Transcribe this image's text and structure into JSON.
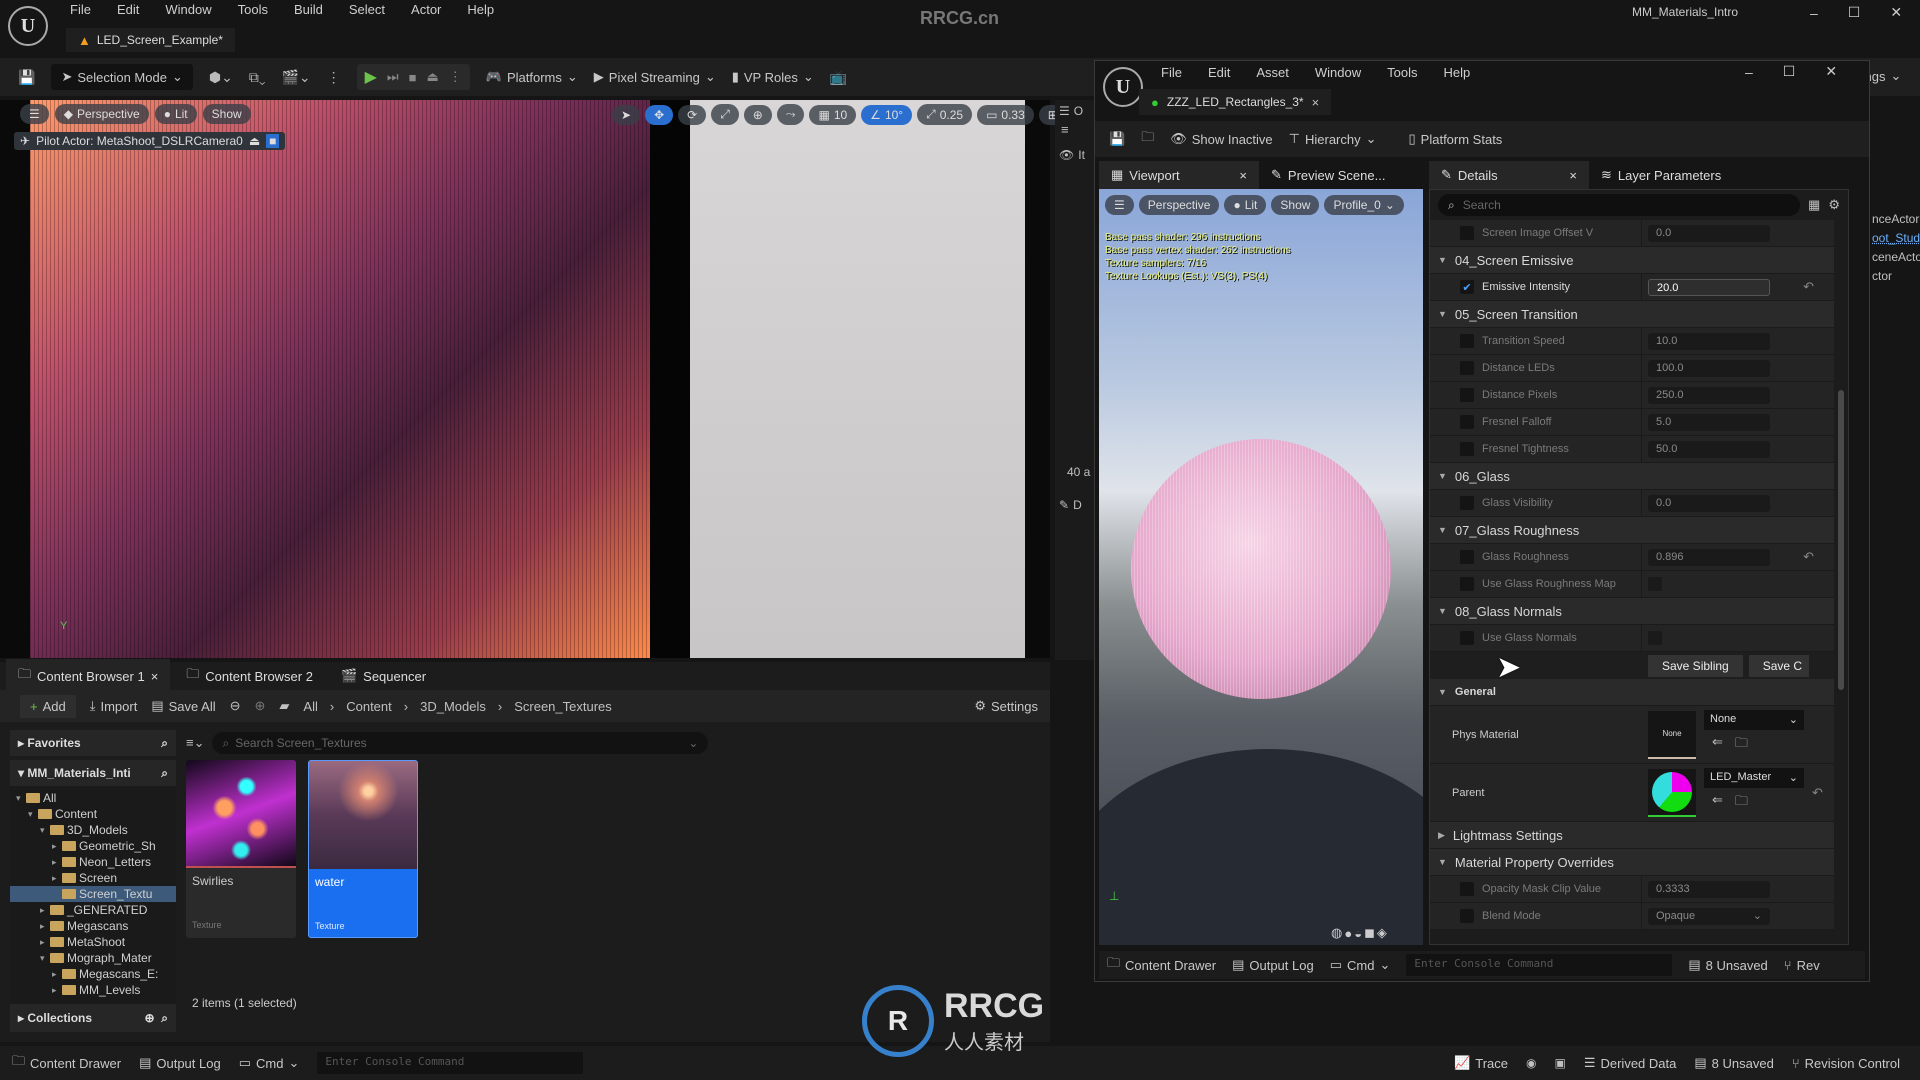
{
  "main_window": {
    "title": "MM_Materials_Intro",
    "watermark": "RRCG.cn",
    "menu": [
      "File",
      "Edit",
      "Window",
      "Tools",
      "Build",
      "Select",
      "Actor",
      "Help"
    ],
    "level_tab": "LED_Screen_Example*",
    "toolbar": {
      "selection_mode": "Selection Mode",
      "platforms": "Platforms",
      "pixel_streaming": "Pixel Streaming",
      "vp_roles": "VP Roles",
      "settings_partial": "tings"
    },
    "viewport": {
      "perspective": "Perspective",
      "lit": "Lit",
      "show": "Show",
      "grid": "10",
      "angle": "10°",
      "scale": "0.25",
      "camera_speed": "0.33",
      "pilot": "Pilot Actor: MetaShoot_DSLRCamera0",
      "axis_label": "Y"
    },
    "outliner_partial": {
      "header": "O",
      "item": "It",
      "count": "40 a",
      "details": "D",
      "items": [
        "nceActor",
        "oot_Studic",
        "ceneActor",
        "ctor"
      ]
    },
    "content_browser": {
      "tabs": [
        "Content Browser 1",
        "Content Browser 2",
        "Sequencer"
      ],
      "add": "Add",
      "import": "Import",
      "save_all": "Save All",
      "breadcrumb": [
        "All",
        "Content",
        "3D_Models",
        "Screen_Textures"
      ],
      "settings": "Settings",
      "favorites": "Favorites",
      "root": "MM_Materials_Inti",
      "search_placeholder": "Search Screen_Textures",
      "tree": [
        {
          "label": "All",
          "depth": 0,
          "open": true
        },
        {
          "label": "Content",
          "depth": 1,
          "open": true
        },
        {
          "label": "3D_Models",
          "depth": 2,
          "open": true
        },
        {
          "label": "Geometric_Sh",
          "depth": 3
        },
        {
          "label": "Neon_Letters",
          "depth": 3
        },
        {
          "label": "Screen",
          "depth": 3
        },
        {
          "label": "Screen_Textu",
          "depth": 3,
          "selected": true
        },
        {
          "label": "_GENERATED",
          "depth": 2
        },
        {
          "label": "Megascans",
          "depth": 2
        },
        {
          "label": "MetaShoot",
          "depth": 2
        },
        {
          "label": "Mograph_Mater",
          "depth": 2,
          "open": true
        },
        {
          "label": "Megascans_E:",
          "depth": 3
        },
        {
          "label": "MM_Levels",
          "depth": 3
        }
      ],
      "collections": "Collections",
      "assets": [
        {
          "name": "Swirlies",
          "type": "Texture",
          "selected": false
        },
        {
          "name": "water",
          "type": "Texture",
          "selected": true
        }
      ],
      "status": "2 items (1 selected)"
    },
    "status_bar": {
      "content_drawer": "Content Drawer",
      "output_log": "Output Log",
      "cmd": "Cmd",
      "console_placeholder": "Enter Console Command",
      "trace": "Trace",
      "derived_data": "Derived Data",
      "unsaved": "8 Unsaved",
      "revision_control": "Revision Control"
    }
  },
  "material_editor": {
    "menu": [
      "File",
      "Edit",
      "Asset",
      "Window",
      "Tools",
      "Help"
    ],
    "asset_tab": "ZZZ_LED_Rectangles_3*",
    "toolbar": {
      "show_inactive": "Show Inactive",
      "hierarchy": "Hierarchy",
      "platform_stats": "Platform Stats"
    },
    "panel_tabs": [
      "Viewport",
      "Preview Scene...",
      "Details",
      "Layer Parameters"
    ],
    "viewport": {
      "perspective": "Perspective",
      "lit": "Lit",
      "show": "Show",
      "profile": "Profile_0",
      "stats": [
        "Base pass shader: 296 instructions",
        "Base pass vertex shader: 262 instructions",
        "Texture samplers: 7/16",
        "Texture Lookups (Est.): VS(3), PS(4)"
      ]
    },
    "details": {
      "search_placeholder": "Search",
      "top_row": {
        "name": "Screen Image Offset V",
        "value": "0.0"
      },
      "sections": [
        {
          "title": "04_Screen Emissive",
          "rows": [
            {
              "name": "Emissive Intensity",
              "value": "20.0",
              "checked": true,
              "reset": true
            }
          ]
        },
        {
          "title": "05_Screen Transition",
          "rows": [
            {
              "name": "Transition Speed",
              "value": "10.0"
            },
            {
              "name": "Distance LEDs",
              "value": "100.0"
            },
            {
              "name": "Distance Pixels",
              "value": "250.0"
            },
            {
              "name": "Fresnel Falloff",
              "value": "5.0"
            },
            {
              "name": "Fresnel Tightness",
              "value": "50.0"
            }
          ]
        },
        {
          "title": "06_Glass",
          "rows": [
            {
              "name": "Glass Visibility",
              "value": "0.0"
            }
          ]
        },
        {
          "title": "07_Glass Roughness",
          "rows": [
            {
              "name": "Glass Roughness",
              "value": "0.896",
              "reset": true
            },
            {
              "name": "Use Glass Roughness Map",
              "bool": true
            }
          ]
        },
        {
          "title": "08_Glass Normals",
          "rows": [
            {
              "name": "Use Glass Normals",
              "bool": true
            }
          ]
        }
      ],
      "save_sibling": "Save Sibling",
      "save_child": "Save C",
      "general": {
        "title": "General",
        "phys_material": "Phys Material",
        "phys_value": "None",
        "phys_thumb": "None",
        "parent": "Parent",
        "parent_value": "LED_Master"
      },
      "lightmass": "Lightmass Settings",
      "mpo": {
        "title": "Material Property Overrides",
        "rows": [
          {
            "name": "Opacity Mask Clip Value",
            "value": "0.3333"
          },
          {
            "name": "Blend Mode",
            "value": "Opaque",
            "dropdown": true
          }
        ]
      }
    },
    "bottom_bar": {
      "content_drawer": "Content Drawer",
      "output_log": "Output Log",
      "cmd": "Cmd",
      "console_placeholder": "Enter Console Command",
      "unsaved": "8 Unsaved",
      "revision": "Rev"
    }
  },
  "overlay_logo": {
    "text": "RRCG",
    "subtitle": "人人素材"
  }
}
